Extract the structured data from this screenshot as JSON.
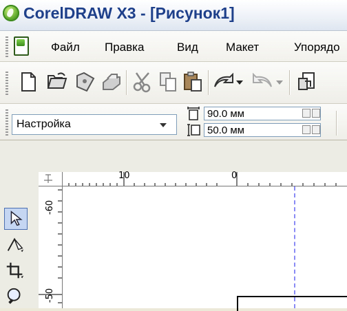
{
  "window": {
    "title": "CorelDRAW X3 - [Рисунок1]"
  },
  "menu": {
    "items": [
      {
        "label": "Файл"
      },
      {
        "label": "Правка"
      },
      {
        "label": "Вид"
      },
      {
        "label": "Макет"
      },
      {
        "label": "Упорядо"
      }
    ]
  },
  "toolbar": {
    "buttons": [
      "new-icon",
      "open-icon",
      "save-icon",
      "print-icon",
      "cut-icon",
      "copy-icon",
      "paste-icon",
      "undo-icon",
      "redo-icon",
      "import-icon"
    ]
  },
  "property_bar": {
    "preset": "Настройка",
    "width": "90.0 мм",
    "height": "50.0 мм"
  },
  "rulers": {
    "h_labels": [
      "10",
      "0"
    ],
    "v_labels": [
      "-60",
      "-50"
    ],
    "corner": "↕"
  },
  "toolbox": {
    "tools": [
      "pick-tool-icon",
      "shape-tool-icon",
      "crop-tool-icon",
      "zoom-tool-icon"
    ]
  },
  "colors": {
    "title_text": "#1e3f8a",
    "guide": "#8b8bf5"
  }
}
